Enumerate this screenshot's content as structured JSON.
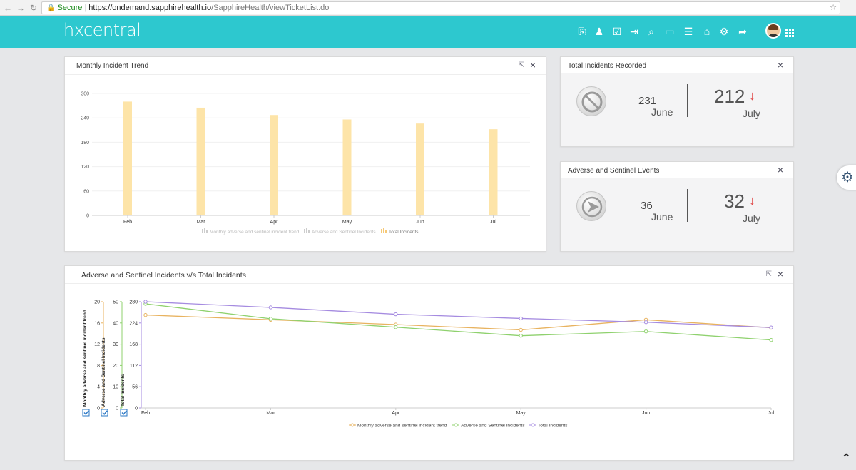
{
  "browser": {
    "secure_label": "Secure",
    "url_host": "https://ondemand.sapphirehealth.io",
    "url_path": "/SapphireHealth/viewTicketList.do"
  },
  "header": {
    "logo": "hxcentral",
    "brand_color": "#2dc8cf",
    "icons": [
      "document-arrow-icon",
      "user-tree-icon",
      "checklist-icon",
      "login-icon",
      "search-icon",
      "monitor-icon",
      "list-icon",
      "home-icon",
      "settings-gear-icon",
      "share-arrow-icon",
      "avatar",
      "apps-grid-icon"
    ]
  },
  "panels": {
    "monthly_trend": {
      "title": "Monthly Incident Trend"
    },
    "total_incidents": {
      "title": "Total Incidents Recorded",
      "previous_value": "231",
      "previous_month": "June",
      "current_value": "212",
      "current_month": "July",
      "trend": "down"
    },
    "adverse_events": {
      "title": "Adverse and Sentinel Events",
      "previous_value": "36",
      "previous_month": "June",
      "current_value": "32",
      "current_month": "July",
      "trend": "down"
    },
    "comparison": {
      "title": "Adverse and Sentinel Incidents v/s Total Incidents"
    }
  },
  "chart_data": [
    {
      "type": "bar",
      "categories": [
        "Feb",
        "Mar",
        "Apr",
        "May",
        "Jun",
        "Jul"
      ],
      "ylim": [
        0,
        300
      ],
      "yticks": [
        0,
        60,
        120,
        180,
        240,
        300
      ],
      "series": [
        {
          "name": "Monthly adverse and sentinel incident trend",
          "values": [],
          "color": "#cccccc"
        },
        {
          "name": "Adverse and Sentinel Incidents",
          "values": [],
          "color": "#cccccc"
        },
        {
          "name": "Total Incidents",
          "values": [
            280,
            265,
            247,
            236,
            226,
            212
          ],
          "color": "#fde4a8"
        }
      ],
      "legend": "bottom"
    },
    {
      "type": "line",
      "categories": [
        "Feb",
        "Mar",
        "Apr",
        "May",
        "Jun",
        "Jul"
      ],
      "axes": [
        {
          "label": "Monthly adverse and sentinel incident trend",
          "ylim": [
            0,
            20
          ],
          "ticks": [
            0,
            4,
            8,
            12,
            16,
            20
          ],
          "color": "#e8b360"
        },
        {
          "label": "Adverse and Sentinel Incidents",
          "ylim": [
            0,
            50
          ],
          "ticks": [
            0,
            10,
            20,
            30,
            40,
            50
          ],
          "color": "#8fd16e"
        },
        {
          "label": "Total Incidents",
          "ylim": [
            0,
            280
          ],
          "ticks": [
            0,
            56,
            112,
            168,
            224,
            280
          ],
          "color": "#a58be0"
        }
      ],
      "series": [
        {
          "name": "Monthly adverse and sentinel incident trend",
          "axis": 0,
          "values": [
            17.5,
            16.6,
            15.7,
            14.7,
            16.6,
            15.1
          ],
          "color": "#e8b360"
        },
        {
          "name": "Adverse and Sentinel Incidents",
          "axis": 1,
          "values": [
            49,
            42,
            38,
            34,
            36,
            32
          ],
          "color": "#8fd16e"
        },
        {
          "name": "Total Incidents",
          "axis": 2,
          "values": [
            280,
            265,
            247,
            236,
            226,
            212
          ],
          "color": "#a58be0"
        }
      ],
      "legend": "bottom"
    }
  ]
}
